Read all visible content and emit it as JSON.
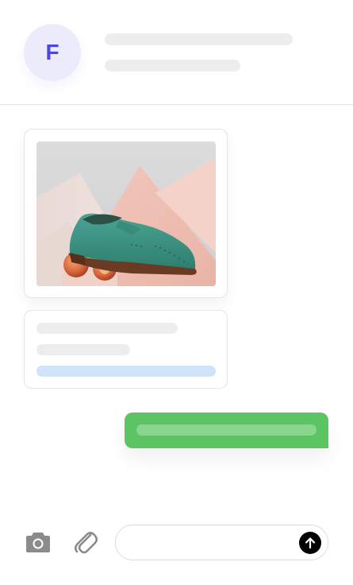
{
  "header": {
    "avatar_initial": "F"
  },
  "composer": {
    "message_value": "",
    "message_placeholder": ""
  },
  "icons": {
    "camera": "camera-icon",
    "attach": "paperclip-icon",
    "send": "arrow-up-icon"
  },
  "colors": {
    "avatar_bg": "#ecebfb",
    "avatar_text": "#4c45e6",
    "skeleton": "#ededed",
    "link_skeleton": "#cfe4fb",
    "outgoing_bubble": "#5dc463",
    "send_button": "#000000"
  }
}
